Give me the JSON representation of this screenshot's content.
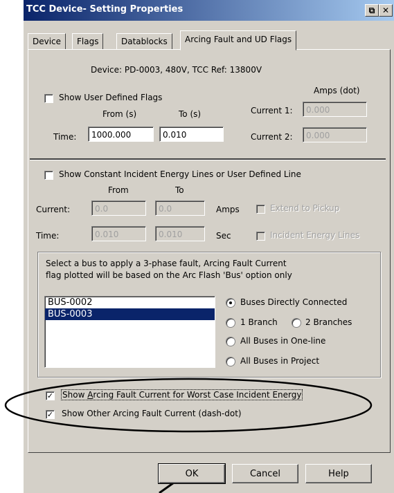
{
  "window": {
    "title": "TCC Device- Setting Properties",
    "restore_glyph": "⧉",
    "close_glyph": "✕"
  },
  "tabs": [
    "Device",
    "Flags",
    "Datablocks",
    "Arcing Fault and UD Flags"
  ],
  "device_info": "Device: PD-0003, 480V, TCC Ref: 13800V",
  "ud_flags": {
    "checkbox_label": "Show User Defined Flags",
    "amps_label": "Amps (dot)",
    "from_label": "From (s)",
    "to_label": "To (s)",
    "time_label": "Time:",
    "time_from": "1000.000",
    "time_to": "0.010",
    "current1_label": "Current 1:",
    "current1_value": "0.000",
    "current2_label": "Current 2:",
    "current2_value": "0.000"
  },
  "ie_lines": {
    "checkbox_label": "Show Constant Incident Energy Lines or User Defined Line",
    "from_label": "From",
    "to_label": "To",
    "current_label": "Current:",
    "current_from": "0.0",
    "current_to": "0.0",
    "amps_unit": "Amps",
    "time_label": "Time:",
    "time_from": "0.010",
    "time_to": "0.010",
    "sec_unit": "Sec",
    "extend_label": "Extend to Pickup",
    "ie_label": "Incident Energy Lines"
  },
  "bus_select": {
    "instruction_1": "Select a bus to apply a 3-phase fault, Arcing Fault Current",
    "instruction_2": "flag plotted will be based on the Arc Flash 'Bus' option only",
    "buses": [
      "BUS-0002",
      "BUS-0003"
    ],
    "selected_index": 1,
    "radio_direct": "Buses Directly Connected",
    "radio_1branch": "1 Branch",
    "radio_2branch": "2 Branches",
    "radio_oneline": "All Buses in One-line",
    "radio_project": "All Buses in Project"
  },
  "arc_options": {
    "worst_case_prefix": "Show ",
    "worst_case_accel": "A",
    "worst_case_rest": "rcing Fault Current for Worst Case Incident Energy",
    "other_label": "Show Other Arcing Fault Current (dash-dot)"
  },
  "buttons": {
    "ok": "OK",
    "cancel": "Cancel",
    "help": "Help"
  }
}
